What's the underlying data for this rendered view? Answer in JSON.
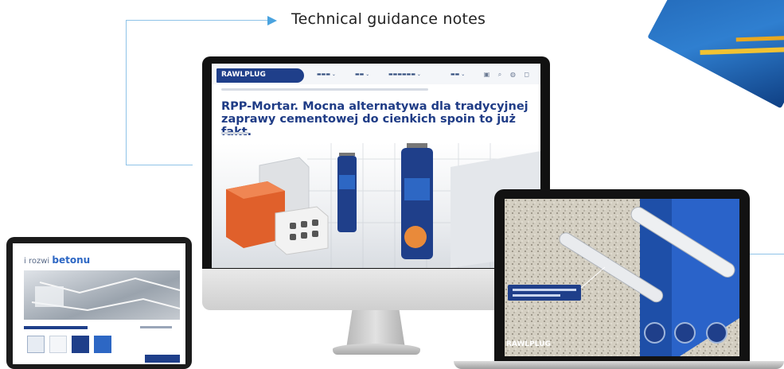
{
  "callout": {
    "label": "Technical guidance notes"
  },
  "imac_site": {
    "logo_text": "RAWLPLUG",
    "headline": "RPP-Mortar. Mocna alternatywa dla tradycyjnej zaprawy cementowej do cienkich spoin to już fakt."
  },
  "tablet_site": {
    "title_prefix": "i rozwi",
    "title_word": "betonu"
  },
  "laptop_site": {
    "logo_text": "RAWLPLUG"
  },
  "colors": {
    "brand_blue": "#1f3f8a",
    "accent_line": "#8fc3e8",
    "arrow": "#4aa3df"
  }
}
